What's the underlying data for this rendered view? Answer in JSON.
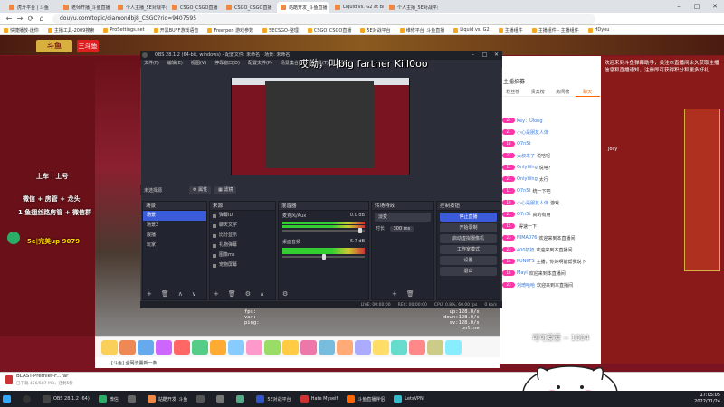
{
  "browser": {
    "tabs": [
      {
        "label": "虎牙平台 | 斗鱼"
      },
      {
        "label": "老师开播_斗鱼直播"
      },
      {
        "label": "个人主播_5E对战平台"
      },
      {
        "label": "CSGO_CSGO直播"
      },
      {
        "label": "CSGO_CSGO直播"
      },
      {
        "label": "站酷开发_斗鱼直播"
      },
      {
        "label": "Liquid vs. G2 at BLAST"
      },
      {
        "label": "个人主播_5E对战平台"
      }
    ],
    "url": "douyu.com/topic/diamondbj8_CSGO?rid=9407595",
    "bookmarks": [
      "快捷播放-迷你",
      "主播工具-2009搜索",
      "ProSettings.net",
      "开黑BUFF游戏语音",
      "Freerpen 游戏参数",
      "5ECSGO-整理",
      "CSGO_CSGO直播",
      "5E对战平台",
      "维修平台_斗鱼直播",
      "Liquid vs. G2",
      "主播组件",
      "主播组件 - 主播组件",
      "HDyou"
    ],
    "nav": {
      "back": "←",
      "forward": "→",
      "reload": "⟳",
      "home": "⌂"
    },
    "window": {
      "minimize": "–",
      "maximize": "□",
      "close": "✕"
    }
  },
  "site": {
    "logo": "斗鱼",
    "logo_en": "三斗鱼"
  },
  "stream_overlay": {
    "line1": "上车 | 上号",
    "line2": "微信 + 房管 + 龙头",
    "line3": "1 鱼翅丝路房管 + 微信群",
    "line4": "5e|完美up 9079"
  },
  "danmaku": "哎呦，叫big farther Kill0oo",
  "obs": {
    "title": "OBS 28.1.2 (64-bit, windows) - 配置文件: 未命名 - 场景: 未命名",
    "menu": [
      "文件(F)",
      "编辑(E)",
      "视图(V)",
      "停靠窗口(D)",
      "配置文件(P)",
      "场景集合(S)",
      "工具(T)",
      "帮助(H)"
    ],
    "window_controls": [
      "–",
      "□",
      "✕"
    ],
    "status_row": {
      "label": "未选择源",
      "props": "属性",
      "filters": "滤镜"
    },
    "docks": {
      "scenes": {
        "header": "场景",
        "items": [
          "场景",
          "场景2",
          "展播",
          "玩家"
        ],
        "selected": 0
      },
      "sources": {
        "header": "来源",
        "items": [
          "弹幕ID",
          "聊天文字",
          "比分显示",
          "礼物弹幕",
          "图像ms",
          "宠物屏幕"
        ]
      },
      "mixer": {
        "header": "混音器",
        "channels": [
          {
            "name": "麦克风/Aux",
            "db": "0.0 dB"
          },
          {
            "name": "桌面音频",
            "db": "-6.7 dB"
          }
        ]
      },
      "transitions": {
        "header": "转场特效",
        "type": "淡变",
        "duration_label": "时长",
        "duration": "300 ms"
      },
      "controls": {
        "header": "控制按钮",
        "buttons": [
          "停止直播",
          "开始录制",
          "启动虚拟摄像机",
          "工作室模式",
          "设置",
          "退出"
        ],
        "active": 0
      }
    },
    "footer_icons": {
      "add": "+",
      "remove": "🗑",
      "settings": "⚙",
      "up": "∧",
      "down": "∨"
    },
    "bottom": {
      "live": "LIVE: 00:00:00",
      "rec": "REC: 00:00:00",
      "cpu": "CPU: 0.8%, 60.00 fps",
      "kb": "0 kb/s"
    }
  },
  "stream_info": {
    "left_lines": [
      "fps:",
      "var:",
      "ping:"
    ],
    "right_lines": [
      "up:128.0/s",
      "down:128.0/s",
      "sv:128.0/s",
      "online"
    ]
  },
  "chat": {
    "top_label": "主播招募",
    "tabs": [
      "粉丝榜",
      "贵宾榜",
      "房间榜",
      "聊天"
    ],
    "lines": [
      {
        "level": "24",
        "name": "Key：Ulong",
        "msg": ""
      },
      {
        "level": "21",
        "name": "小心是朋友人体",
        "msg": ""
      },
      {
        "level": "18",
        "name": "Q7n5t",
        "msg": ""
      },
      {
        "level": "22",
        "name": "大叔来了",
        "msg": "说啥呢"
      },
      {
        "level": "11",
        "name": "OnlyWng",
        "msg": "说啥？"
      },
      {
        "level": "21",
        "name": "OnlyWng",
        "msg": "太行"
      },
      {
        "level": "11",
        "name": "Q7n5t",
        "msg": "统一下吧"
      },
      {
        "level": "19",
        "name": "小心是朋友人体",
        "msg": "游戏"
      },
      {
        "level": "21",
        "name": "Q7n5t",
        "msg": "真的有用"
      },
      {
        "level": "15",
        "name": "",
        "msg": "得速一下"
      },
      {
        "level": "23",
        "name": "NIMA076",
        "msg": "欢迎来到本直播间"
      },
      {
        "level": "23",
        "name": "400奶奶",
        "msg": "欢迎来到本直播间"
      },
      {
        "level": "14",
        "name": "PUNKTS",
        "msg": "主播，你好啊能帮我说下"
      },
      {
        "level": "18",
        "name": "Mayl",
        "msg": "欢迎来到本直播间"
      },
      {
        "level": "23",
        "name": "刘琦哈哈",
        "msg": "欢迎来到本直播间"
      }
    ]
  },
  "right_panel": {
    "notice": "欢迎来到斗鱼弹幕助手，关注本直播间永久获取主播信息和直播通知，注册即可获得积分和更多好礼",
    "username": "Jolly"
  },
  "player": {
    "label": "[斗鱼] 全网流量新一条"
  },
  "download": {
    "file": "BLAST-Premier-F...rar",
    "size": "已下载 456/587 MB，还剩5秒"
  },
  "cute_overlay": {
    "label": "可可爱爱 -- 1004"
  },
  "taskbar": {
    "items": [
      {
        "label": "OBS 28.1.2 (64)",
        "color": "#444"
      },
      {
        "label": "微信",
        "color": "#2aae67"
      },
      {
        "label": "",
        "color": "#666"
      },
      {
        "label": "站酷开发_斗鱼",
        "color": "#e84"
      },
      {
        "label": "",
        "color": "#555"
      },
      {
        "label": "",
        "color": "#777"
      },
      {
        "label": "",
        "color": "#5a8"
      },
      {
        "label": "5E对战平台",
        "color": "#35c"
      },
      {
        "label": "Hate Myself",
        "color": "#c33"
      },
      {
        "label": "斗鱼直播伴侣",
        "color": "#f60"
      },
      {
        "label": "LetsVPN",
        "color": "#3bc"
      }
    ],
    "time": "17:05:05",
    "date": "2022/11/24"
  }
}
